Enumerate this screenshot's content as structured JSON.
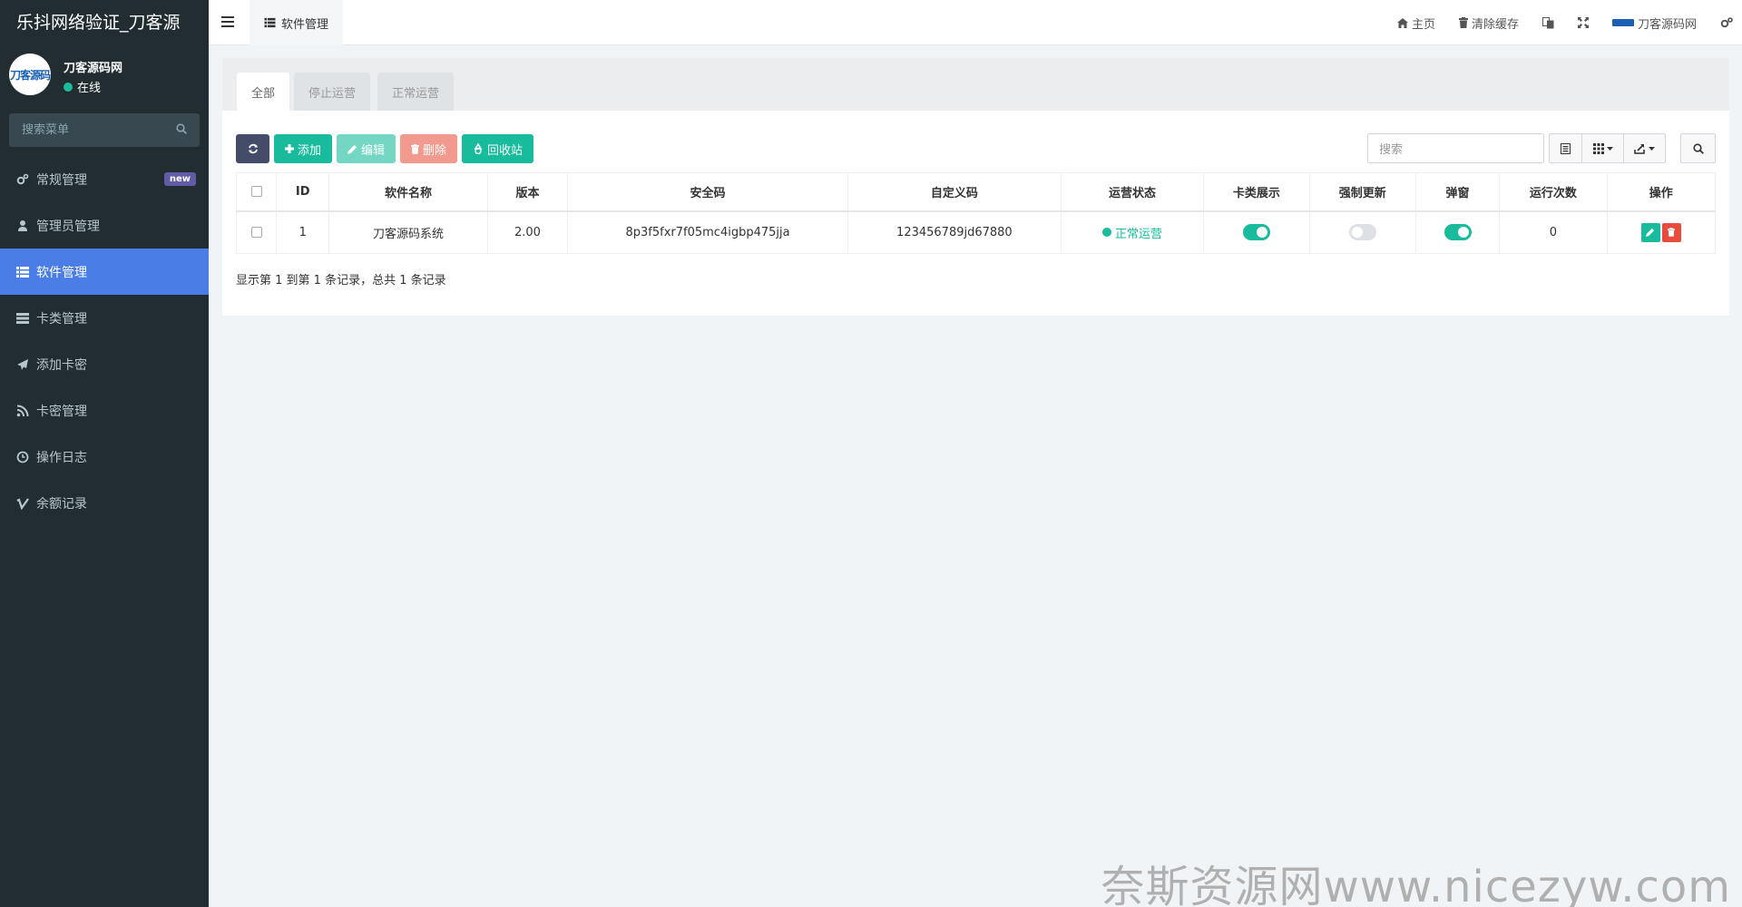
{
  "sidebar": {
    "brand": "乐抖网络验证_刀客源",
    "avatar_text": "刀客源码",
    "user_name": "刀客源码网",
    "user_status": "在线",
    "search_placeholder": "搜索菜单",
    "items": [
      {
        "label": "常规管理",
        "icon": "cogs-icon",
        "badge": "new"
      },
      {
        "label": "管理员管理",
        "icon": "user-icon"
      },
      {
        "label": "软件管理",
        "icon": "list-icon",
        "active": true
      },
      {
        "label": "卡类管理",
        "icon": "server-icon"
      },
      {
        "label": "添加卡密",
        "icon": "paper-plane-icon"
      },
      {
        "label": "卡密管理",
        "icon": "rss-icon"
      },
      {
        "label": "操作日志",
        "icon": "clock-icon"
      },
      {
        "label": "余额记录",
        "icon": "vimeo-icon"
      }
    ]
  },
  "header": {
    "tab_label": "软件管理",
    "home": "主页",
    "clear_cache": "清除缓存",
    "site_name": "刀客源码网"
  },
  "tabs": [
    "全部",
    "停止运营",
    "正常运营"
  ],
  "toolbar": {
    "add": "添加",
    "edit": "编辑",
    "delete": "删除",
    "recycle": "回收站",
    "search_placeholder": "搜索"
  },
  "table": {
    "columns": [
      "ID",
      "软件名称",
      "版本",
      "安全码",
      "自定义码",
      "运营状态",
      "卡类展示",
      "强制更新",
      "弹窗",
      "运行次数",
      "操作"
    ],
    "rows": [
      {
        "id": "1",
        "name": "刀客源码系统",
        "version": "2.00",
        "security_code": "8p3f5fxr7f05mc4igbp475jja",
        "custom_code": "123456789jd67880",
        "status": "正常运营",
        "card_display": true,
        "force_update": false,
        "popup": true,
        "run_count": "0"
      }
    ]
  },
  "pager_info": "显示第 1 到第 1 条记录，总共 1 条记录",
  "watermark": "奈斯资源网www.nicezyw.com",
  "colors": {
    "sidebar_bg": "#222d32",
    "active_menu": "#4a7ee6",
    "primary_green": "#18bc9c",
    "danger": "#e74c3c"
  }
}
